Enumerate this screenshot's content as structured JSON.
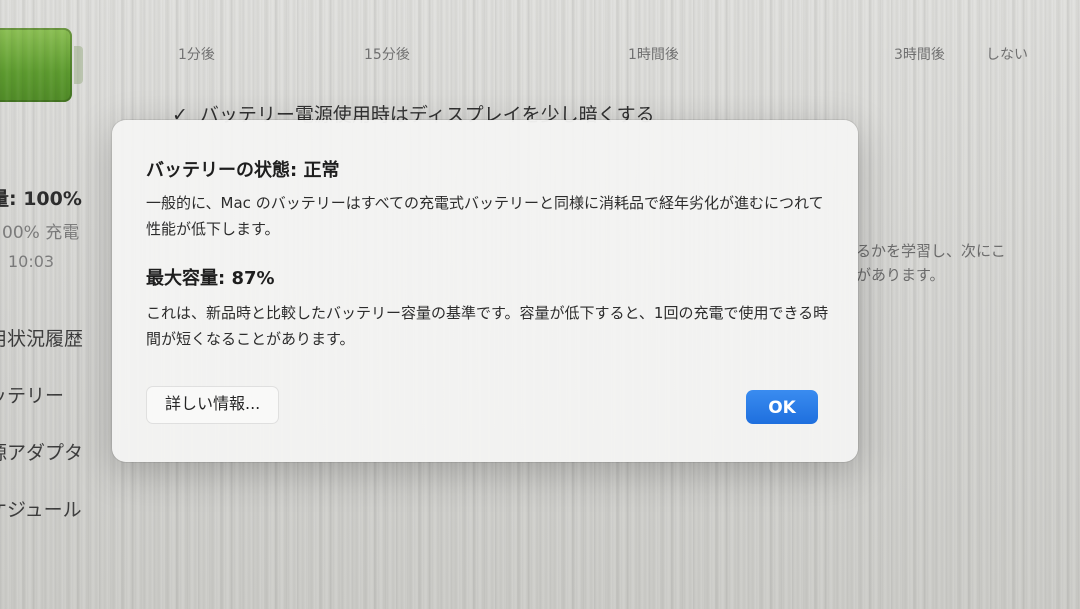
{
  "background": {
    "timeline_labels": [
      "1分後",
      "15分後",
      "1時間後",
      "3時間後",
      "しない"
    ],
    "checkbox": {
      "checked": true,
      "label": "バッテリー電源使用時はディスプレイを少し暗くする"
    },
    "side": {
      "capacity_text": "量: 100%",
      "charged_text": "00% 充電",
      "time_text": "10:03",
      "nav_items": [
        "用状況履歴",
        "ッテリー",
        "源アダプタ",
        "ケジュール"
      ]
    },
    "right_text": [
      "るかを学習し、次にこ",
      "があります。"
    ],
    "colors": {
      "battery_fill": "#5c9a2e",
      "accent": "#1e6fde"
    }
  },
  "dialog": {
    "status_heading": "バッテリーの状態: 正常",
    "status_body": "一般的に、Mac のバッテリーはすべての充電式バッテリーと同様に消耗品で経年劣化が進むにつれて性能が低下します。",
    "capacity_heading": "最大容量: 87%",
    "capacity_body": "これは、新品時と比較したバッテリー容量の基準です。容量が低下すると、1回の充電で使用できる時間が短くなることがあります。",
    "more_info_label": "詳しい情報...",
    "ok_label": "OK"
  }
}
